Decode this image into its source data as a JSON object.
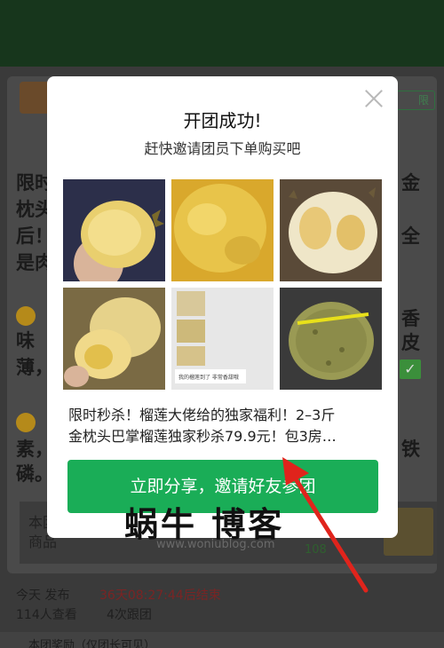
{
  "background": {
    "header_color": "#17361c",
    "tag_label": "限",
    "paragraph1": [
      "限时",
      "枕头",
      "后！",
      "是肉"
    ],
    "paragraph1_right": [
      "金",
      "全"
    ],
    "paragraph2": [
      "味",
      "薄，"
    ],
    "paragraph2_right": [
      "香",
      "皮"
    ],
    "paragraph3": [
      "素，",
      "磷。"
    ],
    "paragraph3_right": [
      "铁"
    ],
    "goods_label": "本团商品",
    "goods_badge": "108",
    "publish_info": "今天 发布",
    "countdown": "36天08:27:44后结束",
    "views": "114人查看",
    "joins": "4次跟团",
    "bottom_text": "本团奖励（仅团长可见）"
  },
  "modal": {
    "title": "开团成功!",
    "subtitle": "赶快邀请团员下单购买吧",
    "images": [
      {
        "name": "durian-in-hand",
        "color": "#e9cf6e"
      },
      {
        "name": "durian-flesh-closeup",
        "color": "#e8c44a"
      },
      {
        "name": "durian-pods-open",
        "color": "#efe6c8"
      },
      {
        "name": "durian-flesh-held",
        "color": "#f0d98a"
      },
      {
        "name": "chat-screenshot",
        "color": "#e7e7e7",
        "caption": "我的榴莲到了 非常香甜哦"
      },
      {
        "name": "whole-durian",
        "color": "#9a9a54"
      }
    ],
    "description_lines": [
      "限时秒杀！榴莲大佬给的独家福利！2–3斤",
      "金枕头巴掌榴莲独家秒杀79.9元！包3房…"
    ],
    "share_button": "立即分享，邀请好友参团",
    "close_icon": "close-icon"
  },
  "watermark": {
    "title": "蜗牛 博客",
    "url": "www.woniublog.com"
  },
  "colors": {
    "primary_green": "#1aad57",
    "arrow_red": "#e0241c"
  }
}
